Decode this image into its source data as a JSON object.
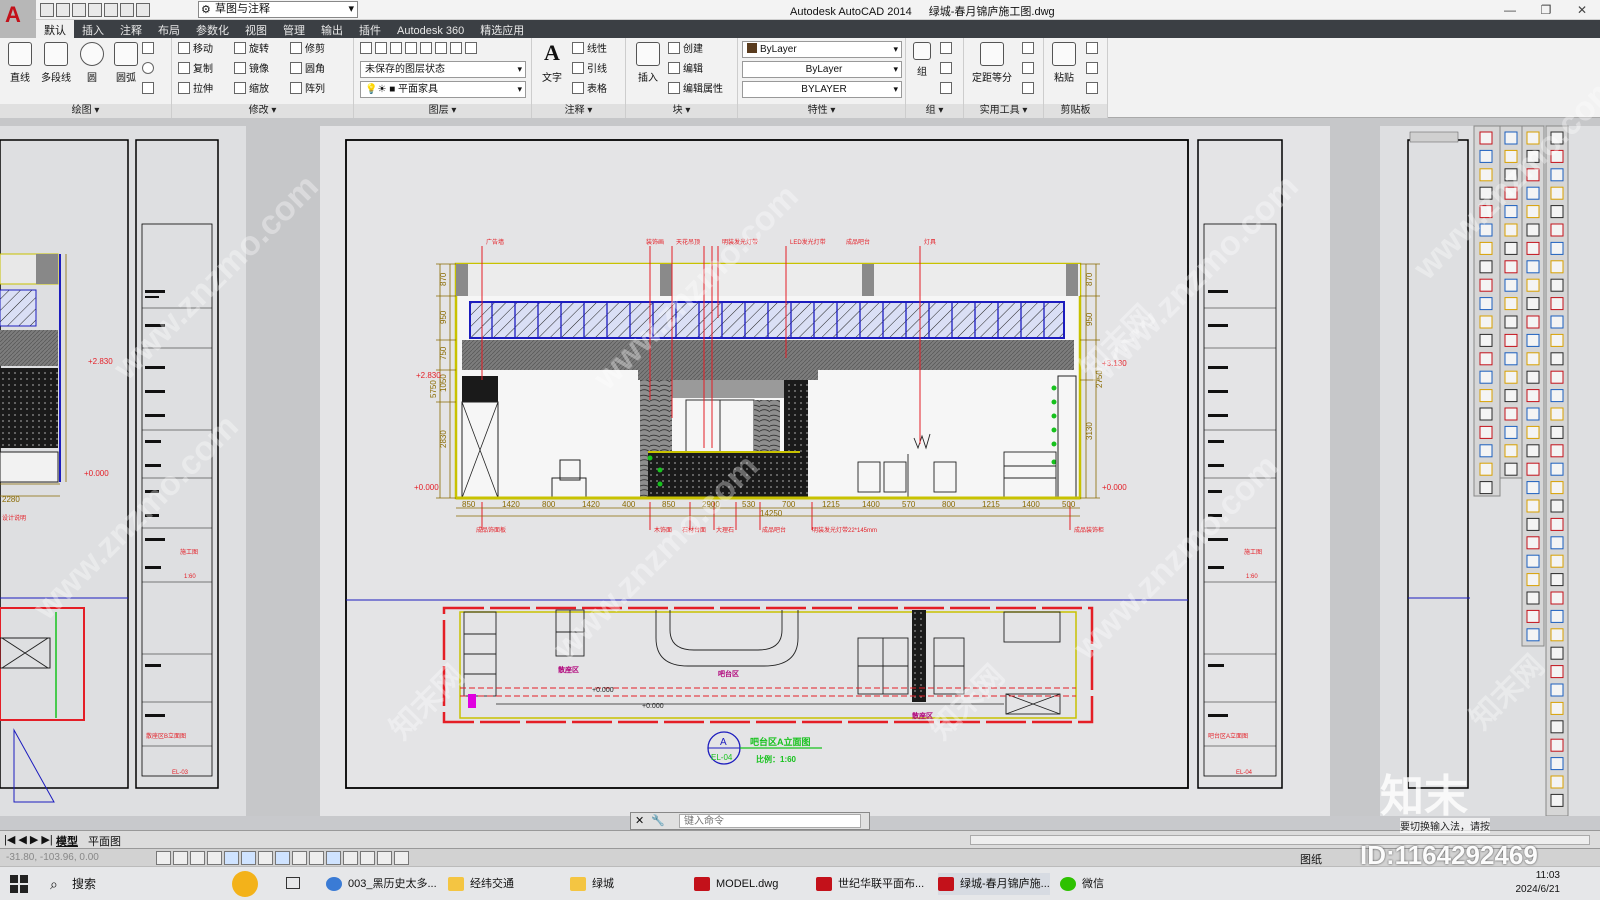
{
  "window": {
    "app_logo": "A",
    "workspace": "草图与注释",
    "app_name": "Autodesk AutoCAD 2014",
    "file_name": "绿城-春月锦庐施工图.dwg",
    "controls": [
      "—",
      "❐",
      "✕"
    ]
  },
  "ribbon_tabs": [
    "默认",
    "插入",
    "注释",
    "布局",
    "参数化",
    "视图",
    "管理",
    "输出",
    "插件",
    "Autodesk 360",
    "精选应用"
  ],
  "panels": {
    "draw": {
      "label": "绘图 ▾",
      "tools": [
        "直线",
        "多段线",
        "圆",
        "圆弧"
      ]
    },
    "modify": {
      "label": "修改 ▾",
      "tools": [
        "移动",
        "旋转",
        "修剪",
        "复制",
        "镜像",
        "圆角",
        "拉伸",
        "缩放",
        "阵列"
      ]
    },
    "layers": {
      "label": "图层 ▾",
      "state": "未保存的图层状态",
      "current": "平面家具"
    },
    "annotation": {
      "label": "注释 ▾",
      "text_tool": "文字",
      "tools": [
        "线性",
        "引线",
        "表格"
      ]
    },
    "block": {
      "label": "块 ▾",
      "insert": "插入",
      "tools": [
        "创建",
        "编辑",
        "编辑属性"
      ]
    },
    "properties": {
      "label": "特性 ▾",
      "color": "ByLayer",
      "linetype": "ByLayer",
      "lineweight": "BYLAYER"
    },
    "groups": {
      "label": "组 ▾",
      "tool": "组"
    },
    "utilities": {
      "label": "实用工具 ▾",
      "tool": "定距等分"
    },
    "clipboard": {
      "label": "剪贴板",
      "tool": "粘贴"
    }
  },
  "drawing": {
    "top_notes": [
      "广告墙",
      "装饰画",
      "天花吊顶",
      "明装发光灯带",
      "LED发光灯带",
      "成品吧台",
      "灯具"
    ],
    "dims_left": [
      "870",
      "950",
      "750",
      "2830",
      "1050",
      "5750"
    ],
    "dims_right": [
      "870",
      "950",
      "2750",
      "3130"
    ],
    "dims_bottom": [
      "850",
      "1420",
      "800",
      "1420",
      "400",
      "850",
      "2900",
      "530",
      "700",
      "1215",
      "1400",
      "570",
      "800",
      "1215",
      "1400",
      "500"
    ],
    "dim_total": "14250",
    "levels": {
      "l1": "+2.830",
      "l2": "+0.000",
      "r1": "+3.130",
      "r2": "+0.000",
      "lp1": "+2.830",
      "lp2": "+0.000"
    },
    "bottom_notes": [
      "成品饰面板",
      "木饰面",
      "石材台面",
      "大理石",
      "成品吧台",
      "明装发光灯带22*145mm",
      "成品装饰柜"
    ],
    "plan_labels": {
      "seat_left": "散座区",
      "bar": "吧台区",
      "seat_right": "散座区",
      "lvl1": "+0.000",
      "lvl2": "+0.000"
    },
    "title": {
      "symbol": "A",
      "code": "EL-04",
      "name": "吧台区A立面图",
      "scale": "比例：1:60"
    },
    "left_dim_bottom": "2280",
    "left_mark": "设计说明",
    "frame_labels": {
      "rev": "施工图",
      "scale": "1:60",
      "sheet_a": "散座区B立面图",
      "sheet_no_a": "EL-03",
      "sheet_b": "吧台区A立面图",
      "sheet_no_b": "EL-04"
    },
    "watermark": "www.znzmo.com",
    "watermark2": "知末网"
  },
  "command": {
    "placeholder": "键入命令"
  },
  "layout_tabs": [
    "模型",
    "平面图"
  ],
  "status": {
    "coords": "-31.80, -103.96, 0.00",
    "model": "图纸"
  },
  "taskbar": {
    "search": "搜索",
    "items": [
      "003_黑历史太多...",
      "经纬交通",
      "绿城",
      "MODEL.dwg",
      "世纪华联平面布...",
      "绿城-春月锦庐施...",
      "微信"
    ],
    "time": "11:03",
    "date": "2024/6/21"
  },
  "overlay": {
    "id": "ID:1164292469",
    "brand": "知末",
    "tip": "要切换输入法，请按"
  },
  "colors": {
    "accent": "#c3111a",
    "paper": "#e4e4e6",
    "frame": "#000000",
    "dim": "#8a6a00",
    "red": "#e41e26",
    "blue": "#1c1cbe",
    "green": "#17c21d",
    "yellow": "#c8c200",
    "magenta": "#b0007a"
  }
}
